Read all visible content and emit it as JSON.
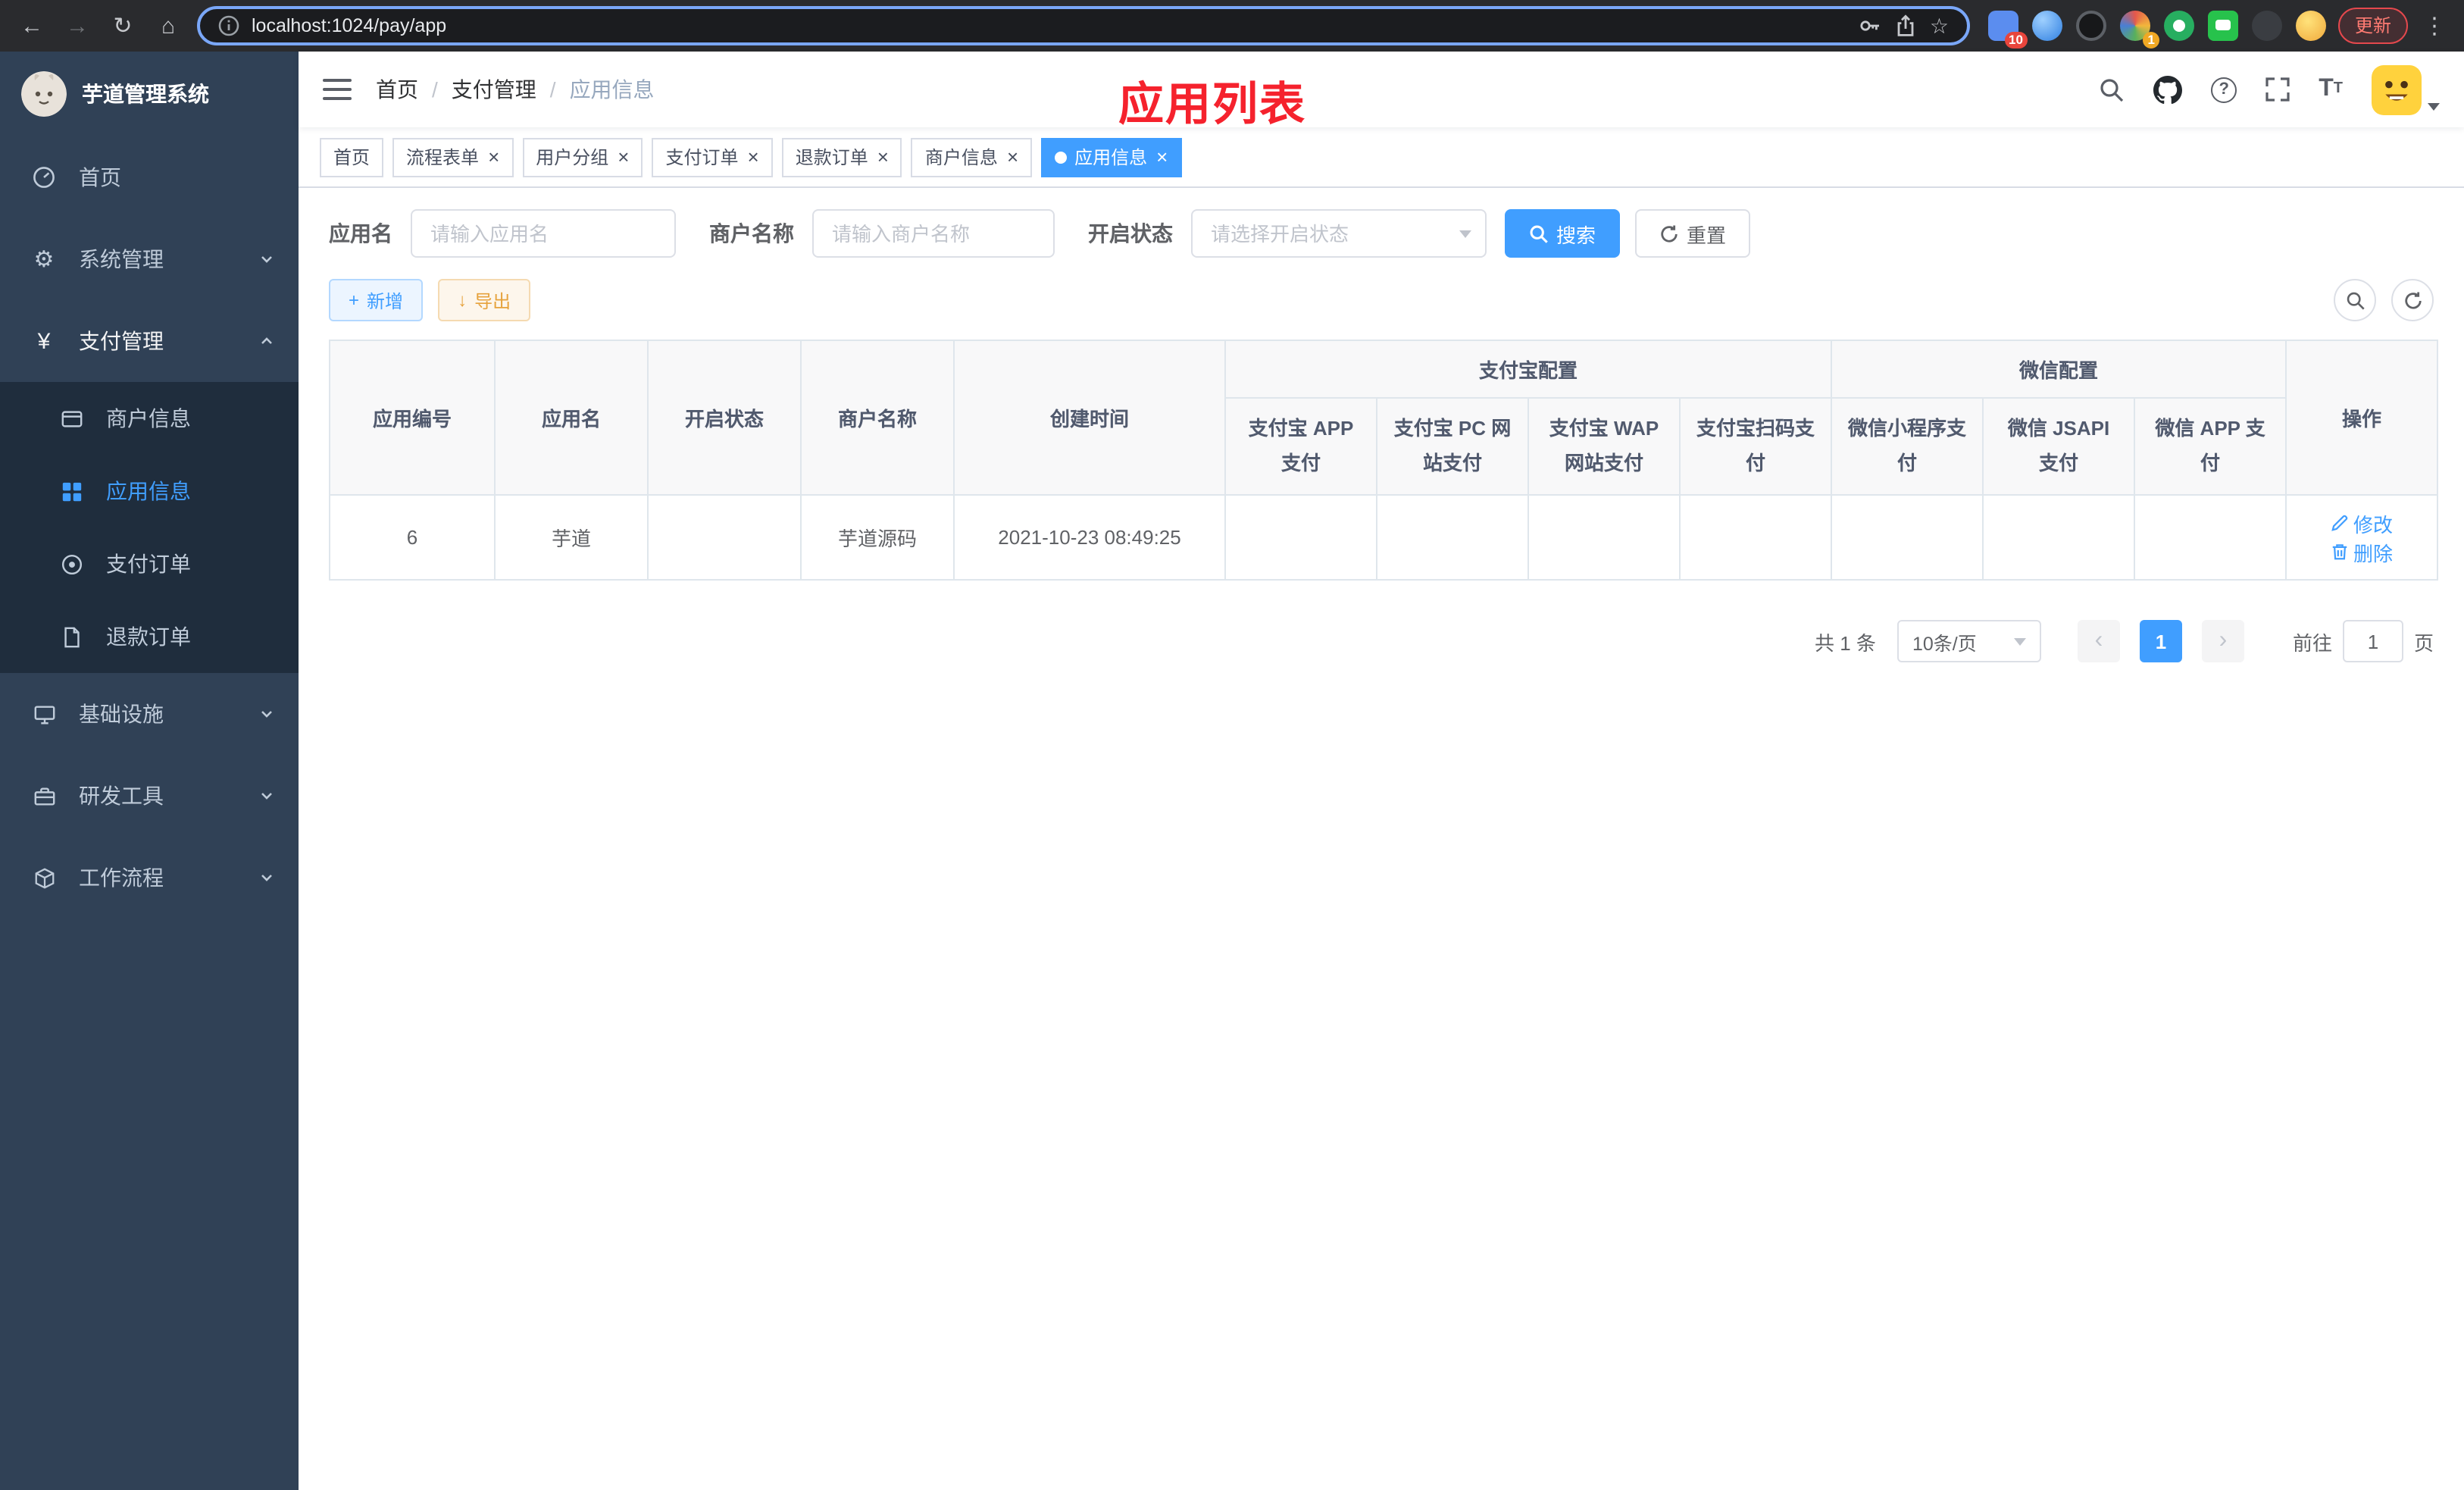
{
  "colors": {
    "primary": "#409eff",
    "success": "#13ce66",
    "danger": "#f56c6c",
    "annotation_red": "#f5222d",
    "sidebar_bg": "#304156",
    "submenu_bg": "#1f2d3d"
  },
  "icons": {
    "back": "←",
    "forward": "→",
    "reload": "↻",
    "home": "⌂",
    "star": "☆",
    "more": "⋮",
    "close": "×",
    "question": "?",
    "font_large": "T",
    "font_small": "T",
    "yen": "¥",
    "gear": "⚙",
    "plus": "+",
    "download": "↓",
    "prev": "‹",
    "next": "›"
  },
  "browser": {
    "url": "localhost:1024/pay/app",
    "update_label": "更新",
    "extensions": {
      "badge_count_1": "10",
      "badge_count_2": "1"
    }
  },
  "sidebar": {
    "title": "芋道管理系统",
    "menu": [
      {
        "label": "首页"
      },
      {
        "label": "系统管理"
      },
      {
        "label": "支付管理"
      },
      {
        "label": "商户信息"
      },
      {
        "label": "应用信息"
      },
      {
        "label": "支付订单"
      },
      {
        "label": "退款订单"
      },
      {
        "label": "基础设施"
      },
      {
        "label": "研发工具"
      },
      {
        "label": "工作流程"
      }
    ]
  },
  "header": {
    "breadcrumb": [
      "首页",
      "支付管理",
      "应用信息"
    ],
    "annotation": "应用列表"
  },
  "tabs": [
    {
      "label": "首页",
      "closable": false,
      "active": false
    },
    {
      "label": "流程表单",
      "closable": true,
      "active": false
    },
    {
      "label": "用户分组",
      "closable": true,
      "active": false
    },
    {
      "label": "支付订单",
      "closable": true,
      "active": false
    },
    {
      "label": "退款订单",
      "closable": true,
      "active": false
    },
    {
      "label": "商户信息",
      "closable": true,
      "active": false
    },
    {
      "label": "应用信息",
      "closable": true,
      "active": true
    }
  ],
  "filter": {
    "app_name_label": "应用名",
    "app_name_placeholder": "请输入应用名",
    "merchant_label": "商户名称",
    "merchant_placeholder": "请输入商户名称",
    "status_label": "开启状态",
    "status_placeholder": "请选择开启状态",
    "search_label": "搜索",
    "reset_label": "重置"
  },
  "toolbar": {
    "add_label": "新增",
    "export_label": "导出"
  },
  "table": {
    "groups": {
      "alipay": "支付宝配置",
      "wechat": "微信配置"
    },
    "columns": {
      "app_id": "应用编号",
      "app_name": "应用名",
      "open_status": "开启状态",
      "merchant_name": "商户名称",
      "create_time": "创建时间",
      "alipay_app": "支付宝 APP 支付",
      "alipay_pc": "支付宝 PC 网站支付",
      "alipay_wap": "支付宝 WAP 网站支付",
      "alipay_qr": "支付宝扫码支付",
      "wx_lite": "微信小程序支付",
      "wx_jsapi": "微信 JSAPI 支付",
      "wx_app": "微信 APP 支付",
      "actions": "操作"
    },
    "row": {
      "app_id": "6",
      "app_name": "芋道",
      "open_status": "on",
      "merchant_name": "芋道源码",
      "create_time": "2021-10-23 08:49:25",
      "edit_label": "修改",
      "delete_label": "删除"
    },
    "row_statuses": {
      "alipay_app": "disabled",
      "alipay_pc": "disabled",
      "alipay_wap": "disabled",
      "alipay_qr": "disabled",
      "wx_lite": "disabled",
      "wx_jsapi": "enabled",
      "wx_app": "disabled"
    }
  },
  "pagination": {
    "total": "共 1 条",
    "page_size": "10条/页",
    "current_page": "1",
    "goto_label": "前往",
    "goto_value": "1",
    "goto_unit": "页"
  }
}
